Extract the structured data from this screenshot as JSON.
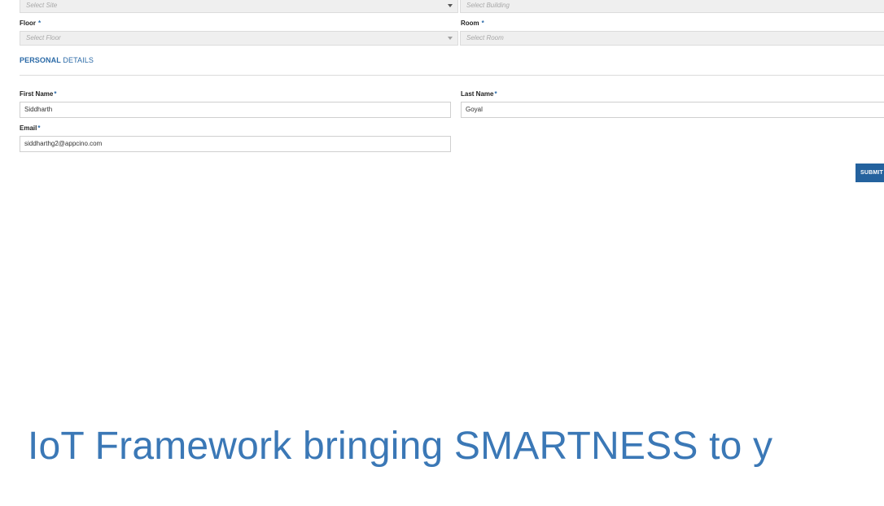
{
  "location": {
    "site": {
      "placeholder": "Select Site"
    },
    "building": {
      "placeholder": "Select Building"
    },
    "floor": {
      "label": "Floor",
      "required_mark": "*",
      "placeholder": "Select Floor"
    },
    "room": {
      "label": "Room",
      "required_mark": "*",
      "placeholder": "Select Room"
    }
  },
  "personal_details": {
    "title_bold": "PERSONAL",
    "title_rest": " DETAILS",
    "first_name": {
      "label": "First Name",
      "required_mark": "*",
      "value": "Siddharth"
    },
    "last_name": {
      "label": "Last Name",
      "required_mark": "*",
      "value": "Goyal"
    },
    "email": {
      "label": "Email",
      "required_mark": "*",
      "value": "siddharthg2@appcino.com"
    }
  },
  "actions": {
    "submit_label": "SUBMIT"
  },
  "banner": {
    "tagline": "IoT Framework bringing SMARTNESS to y"
  },
  "colors": {
    "accent": "#2b6aa7",
    "button": "#24629e",
    "tagline": "#3b78b6"
  }
}
